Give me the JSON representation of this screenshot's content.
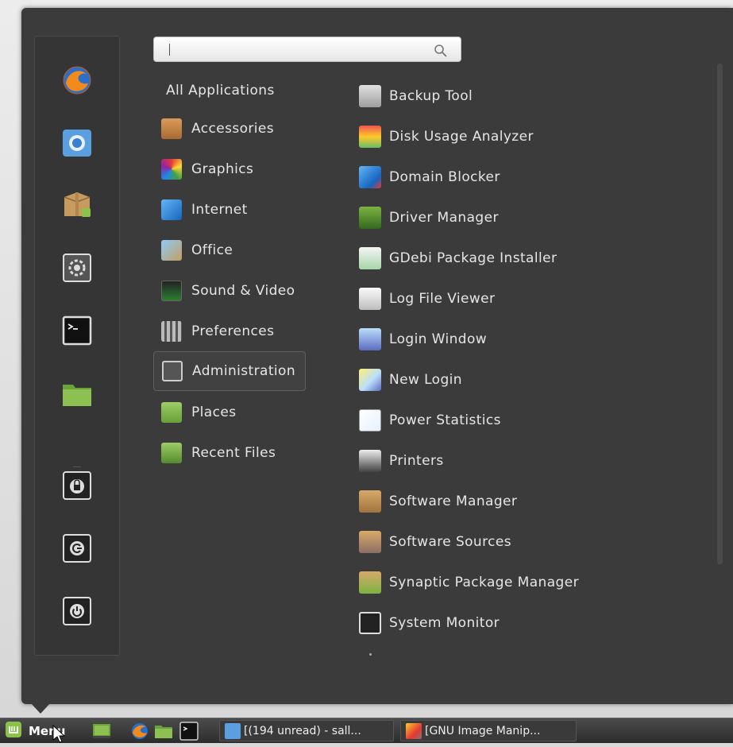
{
  "search": {
    "value": "",
    "placeholder": ""
  },
  "categories": {
    "all_label": "All Applications",
    "items": [
      {
        "label": "Accessories",
        "icon": "calculator-icon"
      },
      {
        "label": "Graphics",
        "icon": "graphics-icon"
      },
      {
        "label": "Internet",
        "icon": "internet-icon"
      },
      {
        "label": "Office",
        "icon": "office-icon"
      },
      {
        "label": "Sound & Video",
        "icon": "sound-video-icon"
      },
      {
        "label": "Preferences",
        "icon": "preferences-icon"
      },
      {
        "label": "Administration",
        "icon": "administration-icon",
        "selected": true
      },
      {
        "label": "Places",
        "icon": "folder-icon"
      },
      {
        "label": "Recent Files",
        "icon": "recent-folder-icon"
      }
    ]
  },
  "applications": [
    {
      "label": "Backup Tool",
      "icon": "backup-icon"
    },
    {
      "label": "Disk Usage Analyzer",
      "icon": "disk-usage-icon"
    },
    {
      "label": "Domain Blocker",
      "icon": "domain-blocker-icon"
    },
    {
      "label": "Driver Manager",
      "icon": "driver-icon"
    },
    {
      "label": "GDebi Package Installer",
      "icon": "package-installer-icon"
    },
    {
      "label": "Log File Viewer",
      "icon": "log-viewer-icon"
    },
    {
      "label": "Login Window",
      "icon": "login-window-icon"
    },
    {
      "label": "New Login",
      "icon": "new-login-icon"
    },
    {
      "label": "Power Statistics",
      "icon": "power-stats-icon"
    },
    {
      "label": "Printers",
      "icon": "printer-icon"
    },
    {
      "label": "Software Manager",
      "icon": "software-manager-icon"
    },
    {
      "label": "Software Sources",
      "icon": "software-sources-icon"
    },
    {
      "label": "Synaptic Package Manager",
      "icon": "synaptic-icon"
    },
    {
      "label": "System Monitor",
      "icon": "system-monitor-icon"
    }
  ],
  "favorites": [
    "firefox-icon",
    "chromium-icon",
    "software-manager-icon",
    "system-settings-icon",
    "terminal-icon",
    "files-icon",
    "lock-screen-icon",
    "logout-icon",
    "shutdown-icon"
  ],
  "taskbar": {
    "menu_label": "Menu",
    "windows": [
      {
        "label": "[(194 unread) - sall...",
        "icon": "chromium-icon"
      },
      {
        "label": "[GNU Image Manip...",
        "icon": "gimp-icon"
      }
    ]
  },
  "colors": {
    "panel_bg": "#3b3b3b",
    "text": "#e6e6e6",
    "accent_green": "#7cb342"
  }
}
